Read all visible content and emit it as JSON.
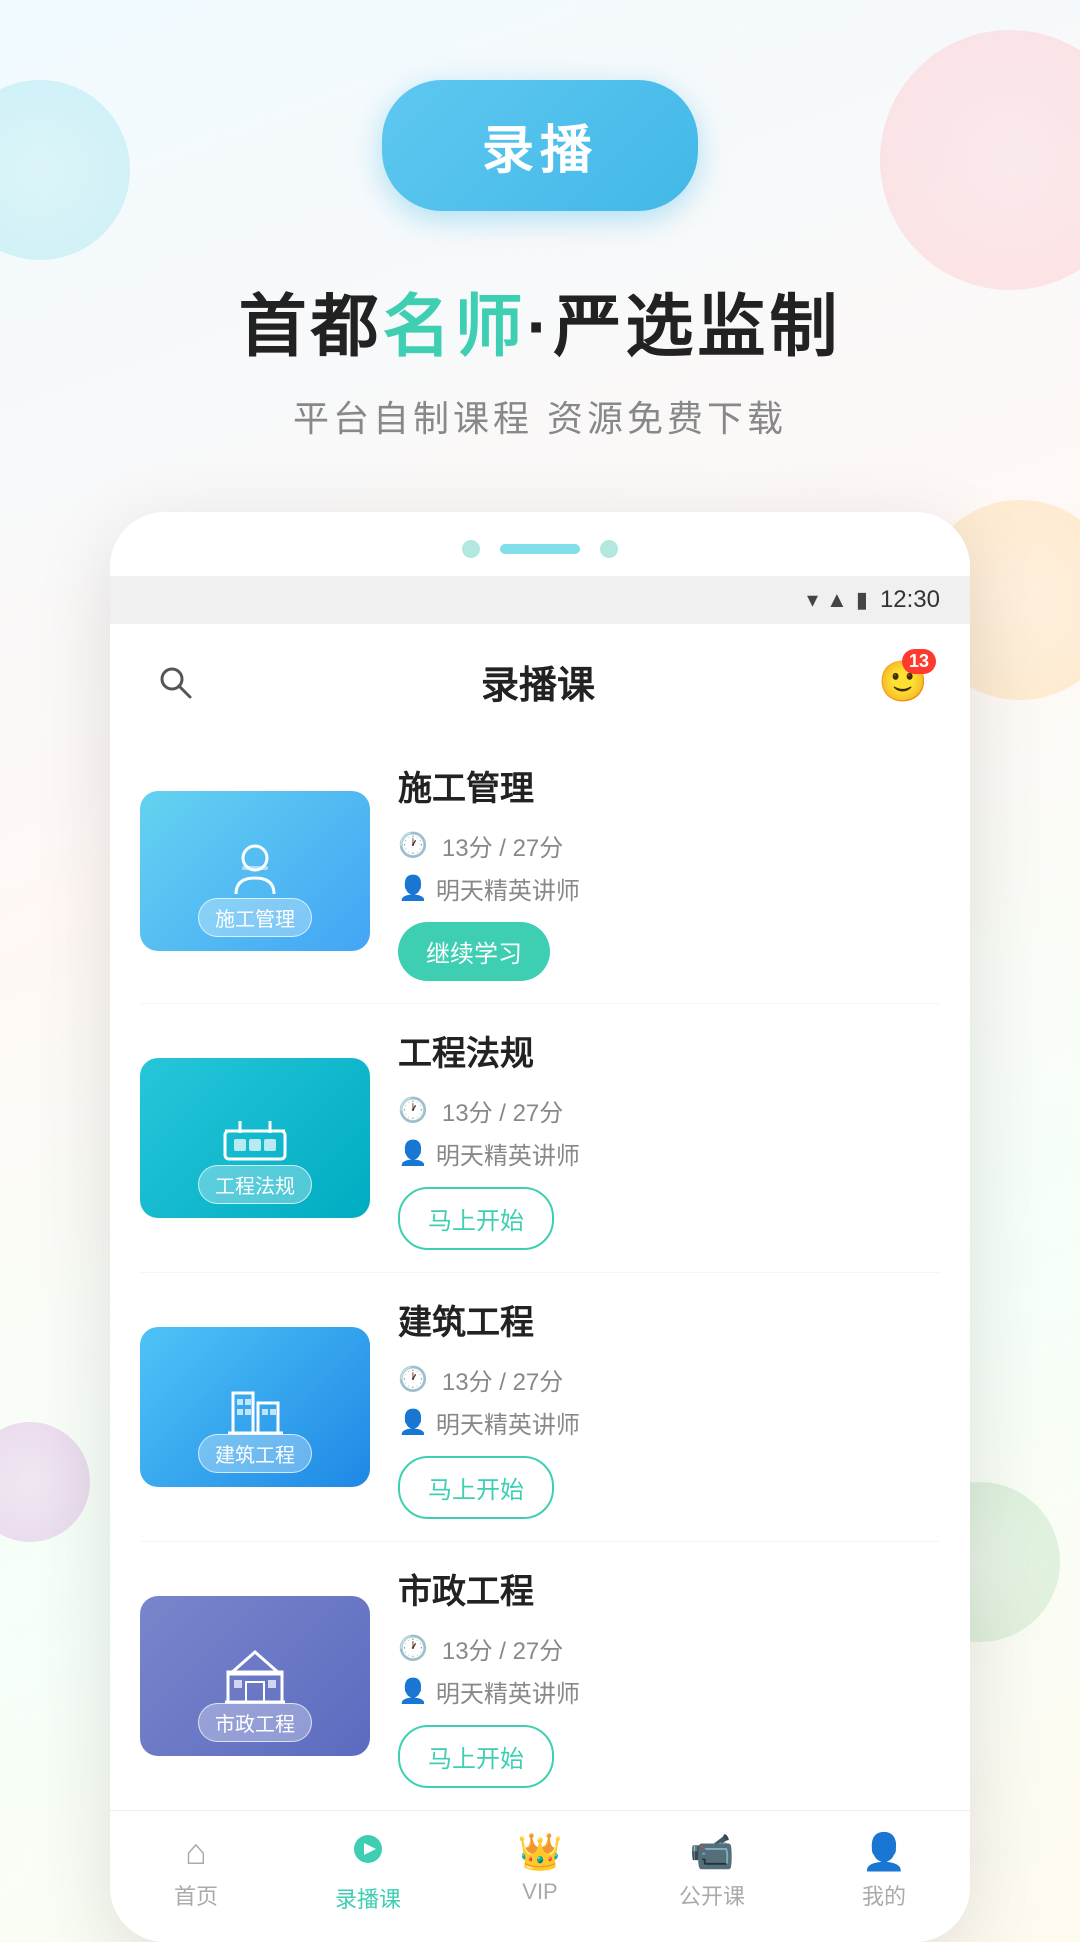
{
  "header": {
    "button_label": "录播",
    "tagline_part1": "首都",
    "tagline_highlight": "名师",
    "tagline_sep": "·",
    "tagline_part2": "严选监制",
    "subtitle": "平台自制课程  资源免费下载"
  },
  "phone": {
    "status_time": "12:30",
    "app_title": "录播课",
    "msg_badge": "13"
  },
  "courses": [
    {
      "id": "shigong",
      "name": "施工管理",
      "thumb_label": "施工管理",
      "thumb_bg": "1",
      "icon": "👷",
      "time": "13分 / 27分",
      "teacher": "明天精英讲师",
      "action": "继续学习",
      "action_type": "continue"
    },
    {
      "id": "gongcheng",
      "name": "工程法规",
      "thumb_label": "工程法规",
      "thumb_bg": "2",
      "icon": "🚧",
      "time": "13分 / 27分",
      "teacher": "明天精英讲师",
      "action": "马上开始",
      "action_type": "start"
    },
    {
      "id": "jianzhu",
      "name": "建筑工程",
      "thumb_label": "建筑工程",
      "thumb_bg": "3",
      "icon": "🏗",
      "time": "13分 / 27分",
      "teacher": "明天精英讲师",
      "action": "马上开始",
      "action_type": "start"
    },
    {
      "id": "shizheng",
      "name": "市政工程",
      "thumb_label": "市政工程",
      "thumb_bg": "4",
      "icon": "🏛",
      "time": "13分 / 27分",
      "teacher": "明天精英讲师",
      "action": "马上开始",
      "action_type": "start"
    }
  ],
  "nav": {
    "items": [
      {
        "id": "home",
        "label": "首页",
        "active": false
      },
      {
        "id": "luzbo",
        "label": "录播课",
        "active": true
      },
      {
        "id": "vip",
        "label": "VIP",
        "active": false
      },
      {
        "id": "live",
        "label": "公开课",
        "active": false
      },
      {
        "id": "mine",
        "label": "我的",
        "active": false
      }
    ]
  }
}
